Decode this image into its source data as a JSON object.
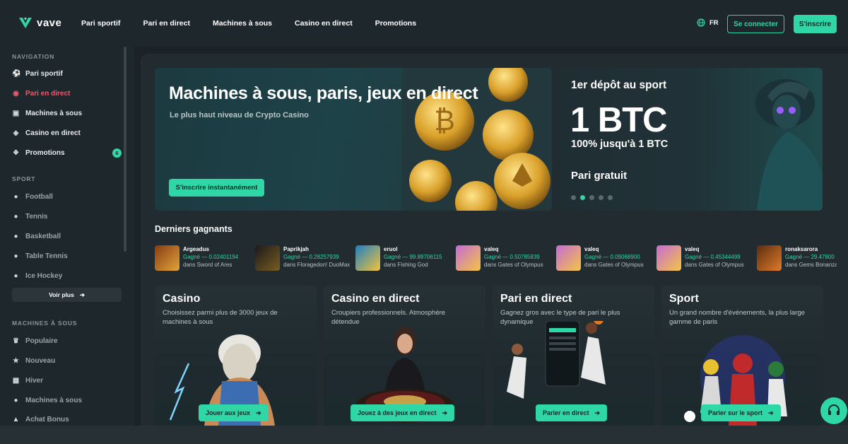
{
  "brand": {
    "name": "vave",
    "accent": "#2fd6a6",
    "live": "#f0586d"
  },
  "topnav": [
    "Pari sportif",
    "Pari en direct",
    "Machines à sous",
    "Casino en direct",
    "Promotions"
  ],
  "header": {
    "lang": "FR",
    "login": "Se connecter",
    "signup": "S'inscrire"
  },
  "sidebar": {
    "nav_title": "NAVIGATION",
    "nav": [
      {
        "label": "Pari sportif",
        "icon": "soccer-ball-icon"
      },
      {
        "label": "Pari en direct",
        "icon": "live-icon"
      },
      {
        "label": "Machines à sous",
        "icon": "slot-icon"
      },
      {
        "label": "Casino en direct",
        "icon": "casino-chip-icon"
      },
      {
        "label": "Promotions",
        "icon": "gift-icon",
        "badge": "6"
      }
    ],
    "sport_title": "SPORT",
    "sport": [
      {
        "label": "Football",
        "icon": "football-icon"
      },
      {
        "label": "Tennis",
        "icon": "tennis-icon"
      },
      {
        "label": "Basketball",
        "icon": "basketball-icon"
      },
      {
        "label": "Table Tennis",
        "icon": "table-tennis-icon"
      },
      {
        "label": "Ice Hockey",
        "icon": "hockey-icon"
      }
    ],
    "see_more": "Voir plus",
    "slots_title": "MACHINES À SOUS",
    "slots": [
      {
        "label": "Populaire",
        "icon": "crown-icon"
      },
      {
        "label": "Nouveau",
        "icon": "star-icon"
      },
      {
        "label": "Hiver",
        "icon": "snow-icon"
      },
      {
        "label": "Machines à sous",
        "icon": "slot-icon"
      },
      {
        "label": "Achat Bonus",
        "icon": "bag-icon"
      }
    ]
  },
  "hero": {
    "title": "Machines à sous, paris, jeux en direct",
    "subtitle": "Le plus haut niveau de Crypto Casino",
    "cta": "S'inscrire instantanément"
  },
  "promo": {
    "kicker": "1er dépôt au sport",
    "amount": "1 BTC",
    "detail": "100% jusqu'à 1 BTC",
    "free": "Pari gratuit",
    "active_dot": 2,
    "dot_count": 5
  },
  "winners": {
    "title": "Derniers gagnants",
    "items": [
      {
        "name": "Argeadus",
        "amount": "Gagné — 0.02401194",
        "game": "dans Sword of Ares"
      },
      {
        "name": "Paprikjah",
        "amount": "Gagné — 0.28257939",
        "game": "dans Floragedon! DuoMax"
      },
      {
        "name": "eruol",
        "amount": "Gagné — 99.89706115",
        "game": "dans Fishing God"
      },
      {
        "name": "valeq",
        "amount": "Gagné — 0.50785839",
        "game": "dans Gates of Olympus"
      },
      {
        "name": "valeq",
        "amount": "Gagné — 0.09068900",
        "game": "dans Gates of Olympus"
      },
      {
        "name": "valeq",
        "amount": "Gagné — 0.45344499",
        "game": "dans Gates of Olympus"
      },
      {
        "name": "ronaksarora",
        "amount": "Gagné — 29.47800",
        "game": "dans Gems Bonanza"
      }
    ]
  },
  "categories": [
    {
      "title": "Casino",
      "desc": "Choisissez parmi plus de 3000 jeux de machines à sous",
      "cta": "Jouer aux jeux"
    },
    {
      "title": "Casino en direct",
      "desc": "Croupiers professionnels. Atmosphère détendue",
      "cta": "Jouez à des jeux en direct"
    },
    {
      "title": "Pari en direct",
      "desc": "Gagnez gros avec le type de pari le plus dynamique",
      "cta": "Parier en direct"
    },
    {
      "title": "Sport",
      "desc": "Un grand nombre d'événements, la plus large gamme de paris",
      "cta": "Parier sur le sport"
    }
  ]
}
